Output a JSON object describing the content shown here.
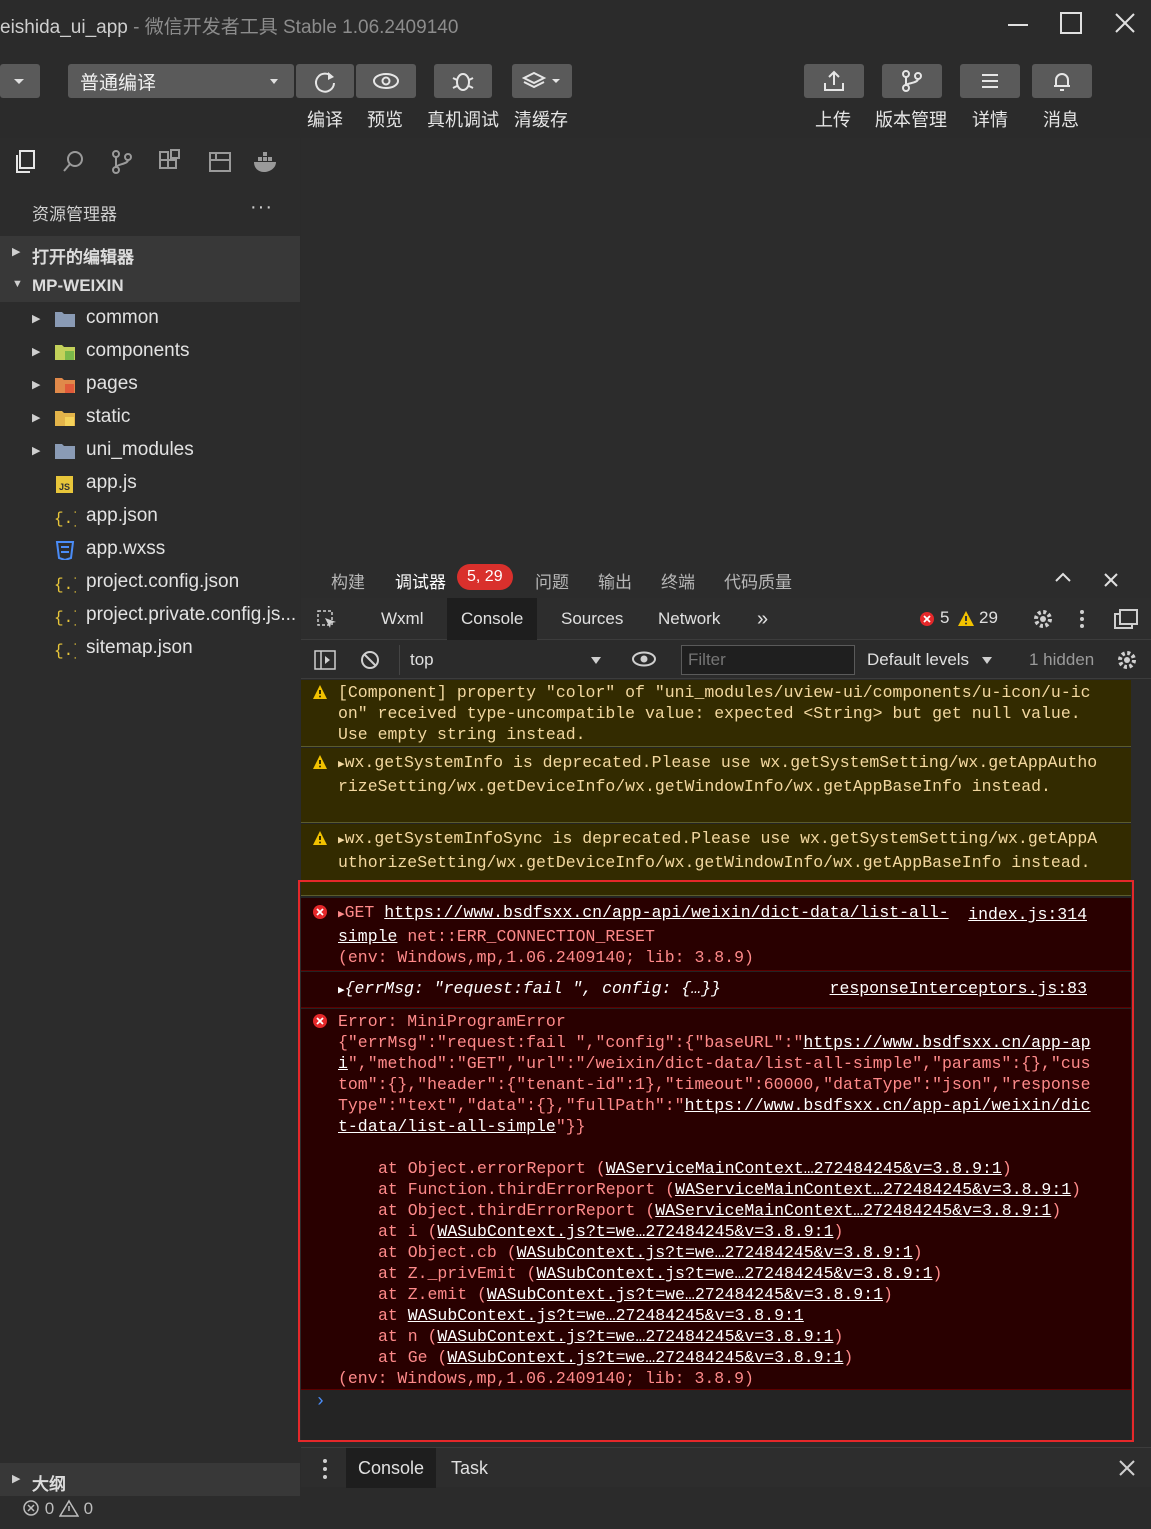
{
  "window": {
    "title_project": "eishida_ui_app",
    "title_sep": " - ",
    "title_app": "微信开发者工具 Stable 1.06.2409140"
  },
  "toolbar": {
    "compile_mode": "普通编译",
    "buttons": [
      {
        "label": "编译",
        "icon": "refresh-icon"
      },
      {
        "label": "预览",
        "icon": "eye-icon"
      },
      {
        "label": "真机调试",
        "icon": "bug-icon"
      },
      {
        "label": "清缓存",
        "icon": "layers-icon"
      }
    ],
    "right_buttons": [
      {
        "label": "上传",
        "icon": "upload-icon"
      },
      {
        "label": "版本管理",
        "icon": "branch-icon"
      },
      {
        "label": "详情",
        "icon": "menu-icon"
      },
      {
        "label": "消息",
        "icon": "bell-icon"
      }
    ]
  },
  "sidebar": {
    "explorer_title": "资源管理器",
    "more": "···",
    "open_editors": "打开的编辑器",
    "root": "MP-WEIXIN",
    "items": [
      {
        "name": "common",
        "type": "folder"
      },
      {
        "name": "components",
        "type": "folder"
      },
      {
        "name": "pages",
        "type": "folder"
      },
      {
        "name": "static",
        "type": "folder"
      },
      {
        "name": "uni_modules",
        "type": "folder"
      },
      {
        "name": "app.js",
        "type": "file"
      },
      {
        "name": "app.json",
        "type": "file"
      },
      {
        "name": "app.wxss",
        "type": "file"
      },
      {
        "name": "project.config.json",
        "type": "file"
      },
      {
        "name": "project.private.config.js...",
        "type": "file"
      },
      {
        "name": "sitemap.json",
        "type": "file"
      }
    ],
    "outline": "大纲",
    "status_errors": "0",
    "status_warnings": "0"
  },
  "devtools": {
    "tabs": [
      "构建",
      "调试器",
      "问题",
      "输出",
      "终端",
      "代码质量"
    ],
    "debugger_badge": "5, 29",
    "panel_tabs": [
      "Wxml",
      "Console",
      "Sources",
      "Network"
    ],
    "more_tabs": "»",
    "error_count": "5",
    "warning_count": "29",
    "context": "top",
    "filter_placeholder": "Filter",
    "levels": "Default levels",
    "hidden": "1 hidden",
    "prompt": "›",
    "drawer_tabs": [
      "Console",
      "Task"
    ]
  },
  "console": {
    "warn1": "[Component] property \"color\" of \"uni_modules/uview-ui/components/u-icon/u-icon\" received type-uncompatible value: expected <String> but get null value. Use empty string instead.",
    "warn2": "wx.getSystemInfo is deprecated.Please use wx.getSystemSetting/wx.getAppAuthorizeSetting/wx.getDeviceInfo/wx.getWindowInfo/wx.getAppBaseInfo instead.",
    "warn3": "wx.getSystemInfoSync is deprecated.Please use wx.getSystemSetting/wx.getAppAuthorizeSetting/wx.getDeviceInfo/wx.getWindowInfo/wx.getAppBaseInfo instead.",
    "get_method": "GET ",
    "get_url": "https://www.bsdfsxx.cn/app-api/weixin/dict-data/list-all-simple",
    "get_error": " net::ERR_CONNECTION_RESET",
    "get_env": "(env: Windows,mp,1.06.2409140; lib: 3.8.9)",
    "get_source": "index.js:314",
    "obj_summary": "{errMsg: \"request:fail \", config: {…}}",
    "obj_source": "responseInterceptors.js:83",
    "err_head": "Error: MiniProgramError",
    "err_json_a": "{\"errMsg\":\"request:fail \",\"config\":{\"baseURL\":\"",
    "err_json_url1": "https://www.bsdfsxx.cn/app-api",
    "err_json_b": "\",\"method\":\"GET\",\"url\":\"/weixin/dict-data/list-all-simple\",\"params\":{},\"custom\":{},\"header\":{\"tenant-id\":1},\"timeout\":60000,\"dataType\":\"json\",\"responseType\":\"text\",\"data\":{},\"fullPath\":\"",
    "err_json_url2": "https://www.bsdfsxx.cn/app-api/weixin/dict-data/list-all-simple",
    "err_json_c": "\"}}",
    "stack": [
      {
        "fn": "at Object.errorReport (",
        "src": "WAServiceMainContext…272484245&v=3.8.9:1",
        "end": ")"
      },
      {
        "fn": "at Function.thirdErrorReport (",
        "src": "WAServiceMainContext…272484245&v=3.8.9:1",
        "end": ")"
      },
      {
        "fn": "at Object.thirdErrorReport (",
        "src": "WAServiceMainContext…272484245&v=3.8.9:1",
        "end": ")"
      },
      {
        "fn": "at i (",
        "src": "WASubContext.js?t=we…272484245&v=3.8.9:1",
        "end": ")"
      },
      {
        "fn": "at Object.cb (",
        "src": "WASubContext.js?t=we…272484245&v=3.8.9:1",
        "end": ")"
      },
      {
        "fn": "at Z._privEmit (",
        "src": "WASubContext.js?t=we…272484245&v=3.8.9:1",
        "end": ")"
      },
      {
        "fn": "at Z.emit (",
        "src": "WASubContext.js?t=we…272484245&v=3.8.9:1",
        "end": ")"
      },
      {
        "fn": "at ",
        "src": "WASubContext.js?t=we…272484245&v=3.8.9:1",
        "end": ""
      },
      {
        "fn": "at n (",
        "src": "WASubContext.js?t=we…272484245&v=3.8.9:1",
        "end": ")"
      },
      {
        "fn": "at Ge (",
        "src": "WASubContext.js?t=we…272484245&v=3.8.9:1",
        "end": ")"
      }
    ],
    "err_env": "(env: Windows,mp,1.06.2409140; lib: 3.8.9)"
  },
  "colors": {
    "error": "#e5282a",
    "warning": "#f2c200",
    "accent": "#4a8cf7"
  }
}
